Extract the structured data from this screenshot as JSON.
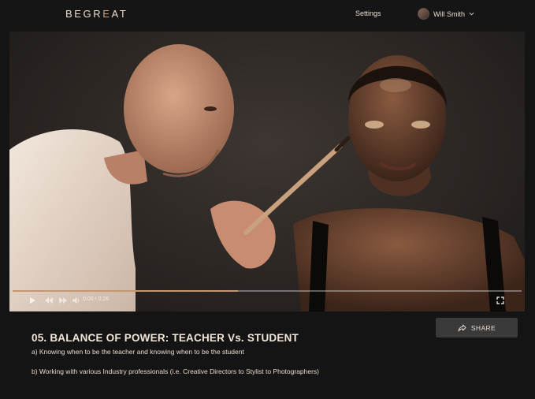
{
  "brand": {
    "logo_prefix": "BEGR",
    "logo_accent": "E",
    "logo_suffix": "AT"
  },
  "header": {
    "settings_label": "Settings",
    "user_name": "Will Smith"
  },
  "player": {
    "time_display": "0:00 / 0:26",
    "progress_fraction": 0.443,
    "icons": [
      "play-icon",
      "rewind-icon",
      "forward-icon",
      "volume-icon",
      "fullscreen-icon"
    ]
  },
  "lesson": {
    "title": "05. BALANCE OF POWER: TEACHER Vs. STUDENT",
    "points": [
      "a) Knowing when to be the teacher and knowing when to be the student",
      "b) Working with various Industry professionals (i.e. Creative Directors to Stylist to Photographers)"
    ],
    "share_label": "SHARE"
  },
  "colors": {
    "background": "#141414",
    "text": "#e9ddd0",
    "accent": "#c59672",
    "button": "#3a3a3a"
  }
}
